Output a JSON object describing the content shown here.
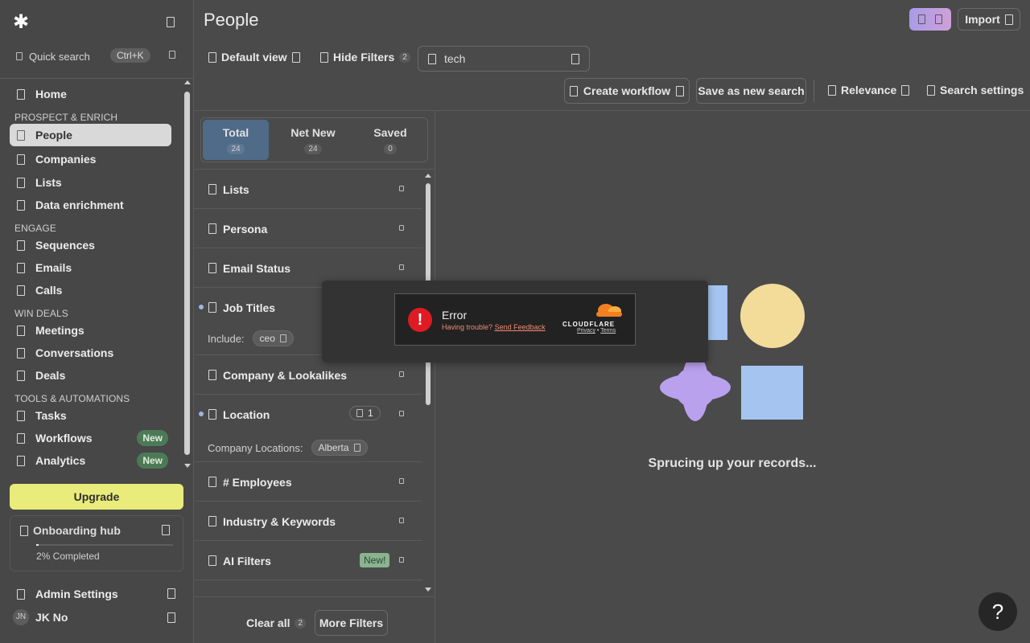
{
  "sidebar": {
    "logo": "✱",
    "quick_search": {
      "label": "Quick search",
      "shortcut": "Ctrl+K"
    },
    "nav": {
      "home": "Home",
      "prospect_section": "PROSPECT & ENRICH",
      "people": "People",
      "companies": "Companies",
      "lists": "Lists",
      "data_enrichment": "Data enrichment",
      "engage_section": "ENGAGE",
      "sequences": "Sequences",
      "emails": "Emails",
      "calls": "Calls",
      "win_section": "WIN DEALS",
      "meetings": "Meetings",
      "conversations": "Conversations",
      "deals": "Deals",
      "tools_section": "TOOLS & AUTOMATIONS",
      "tasks": "Tasks",
      "workflows": "Workflows",
      "workflows_badge": "New",
      "analytics": "Analytics",
      "analytics_badge": "New"
    },
    "upgrade": "Upgrade",
    "onboarding": {
      "title": "Onboarding hub",
      "progress_label": "2% Completed",
      "progress": 0.02
    },
    "admin": "Admin Settings",
    "user": {
      "initials": "JN",
      "name": "JK No"
    }
  },
  "header": {
    "title": "People",
    "import": "Import",
    "default_view": "Default view",
    "hide_filters": "Hide Filters",
    "hide_filters_count": "2",
    "search_value": "tech",
    "create_workflow": "Create workflow",
    "save_search": "Save as new search",
    "relevance": "Relevance",
    "search_settings": "Search settings"
  },
  "tabs": [
    {
      "label": "Total",
      "count": "24"
    },
    {
      "label": "Net New",
      "count": "24"
    },
    {
      "label": "Saved",
      "count": "0"
    }
  ],
  "filters": {
    "lists": "Lists",
    "persona": "Persona",
    "email_status": "Email Status",
    "job_titles": "Job Titles",
    "job_include_label": "Include:",
    "job_include_chip": "ceo",
    "company": "Company & Lookalikes",
    "location": "Location",
    "location_count": "1",
    "location_sub_label": "Company Locations:",
    "location_chip": "Alberta",
    "employees": "# Employees",
    "industry": "Industry & Keywords",
    "ai_filters": "AI Filters",
    "ai_badge": "New!",
    "clear_all": "Clear all",
    "clear_count": "2",
    "more_filters": "More Filters"
  },
  "main": {
    "loading": "Sprucing up your records..."
  },
  "modal": {
    "error_title": "Error",
    "error_sub": "Having trouble?",
    "feedback_link": "Send Feedback",
    "brand": "CLOUDFLARE",
    "privacy": "Privacy",
    "separator": "•",
    "terms": "Terms"
  },
  "help": "?",
  "colors": {
    "background": "#4a4a4a",
    "upgrade": "#e9ec7a",
    "active_tab": "#4f6b88",
    "badge_new": "#4d7a56",
    "error_red": "#de1b23",
    "cloudflare_orange": "#f38020"
  }
}
